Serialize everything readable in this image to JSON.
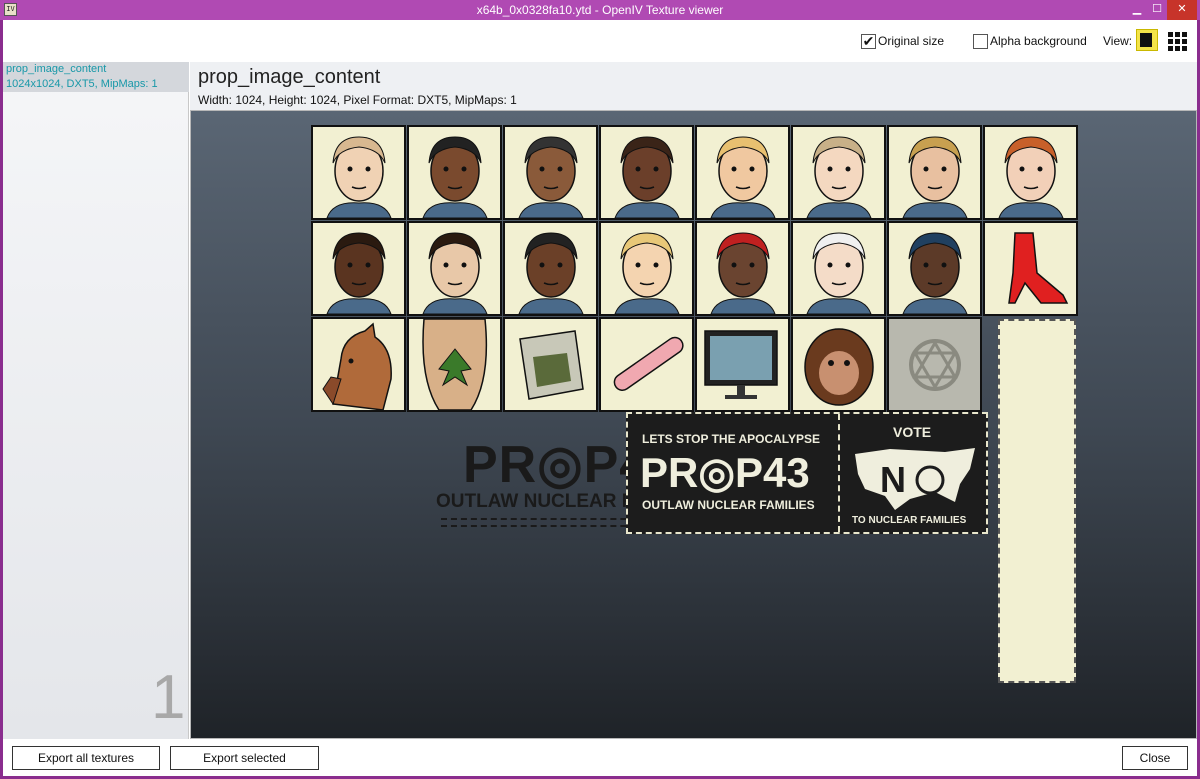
{
  "window": {
    "title": "x64b_0x0328fa10.ytd - OpenIV Texture viewer",
    "icon_label": "IV",
    "minimize_glyph": "▁",
    "maximize_glyph": "☐",
    "close_glyph": "✕"
  },
  "toolbar": {
    "original_size_label": "Original size",
    "original_size_checked": true,
    "alpha_background_label": "Alpha background",
    "alpha_background_checked": false,
    "view_label": "View:",
    "view_modes": [
      "single-view-icon",
      "grid-view-icon"
    ],
    "view_selected": "single",
    "check_glyph": "✔"
  },
  "texture_list": {
    "items": [
      {
        "name": "prop_image_content",
        "info": "1024x1024, DXT5, MipMaps: 1"
      }
    ],
    "page_number": "1"
  },
  "details": {
    "name": "prop_image_content",
    "info": "Width: 1024, Height: 1024, Pixel Format: DXT5, MipMaps: 1"
  },
  "texture": {
    "prop_logo_text": "PR◎P43",
    "prop_subtitle": "OUTLAW NUCLEAR FAMILIES",
    "banner_top": "LETS STOP THE APOCALYPSE",
    "banner_logo": "PR◎P43",
    "banner_subtitle": "OUTLAW NUCLEAR FAMILIES",
    "vote_text": "VOTE",
    "vote_bottom": "TO NUCLEAR FAMILIES",
    "tile_subjects": [
      "man-portrait",
      "man-portrait",
      "man-portrait",
      "woman-portrait",
      "woman-portrait",
      "woman-portrait",
      "woman-portrait",
      "woman-portrait",
      "woman-portrait",
      "woman-portrait",
      "man-portrait",
      "woman-portrait",
      "man-portrait",
      "woman-portrait",
      "man-portrait",
      "red-heel",
      "horse",
      "leaf-body",
      "bag",
      "tube",
      "tv",
      "chimp",
      "emblem"
    ],
    "colors": {
      "tile_bg": "#f2f0d2",
      "skin_light": "#f0d2b4",
      "skin_dark": "#7a4a2e",
      "heel_red": "#e02020"
    }
  },
  "footer": {
    "export_all_label": "Export all textures",
    "export_selected_label": "Export selected",
    "close_label": "Close"
  }
}
